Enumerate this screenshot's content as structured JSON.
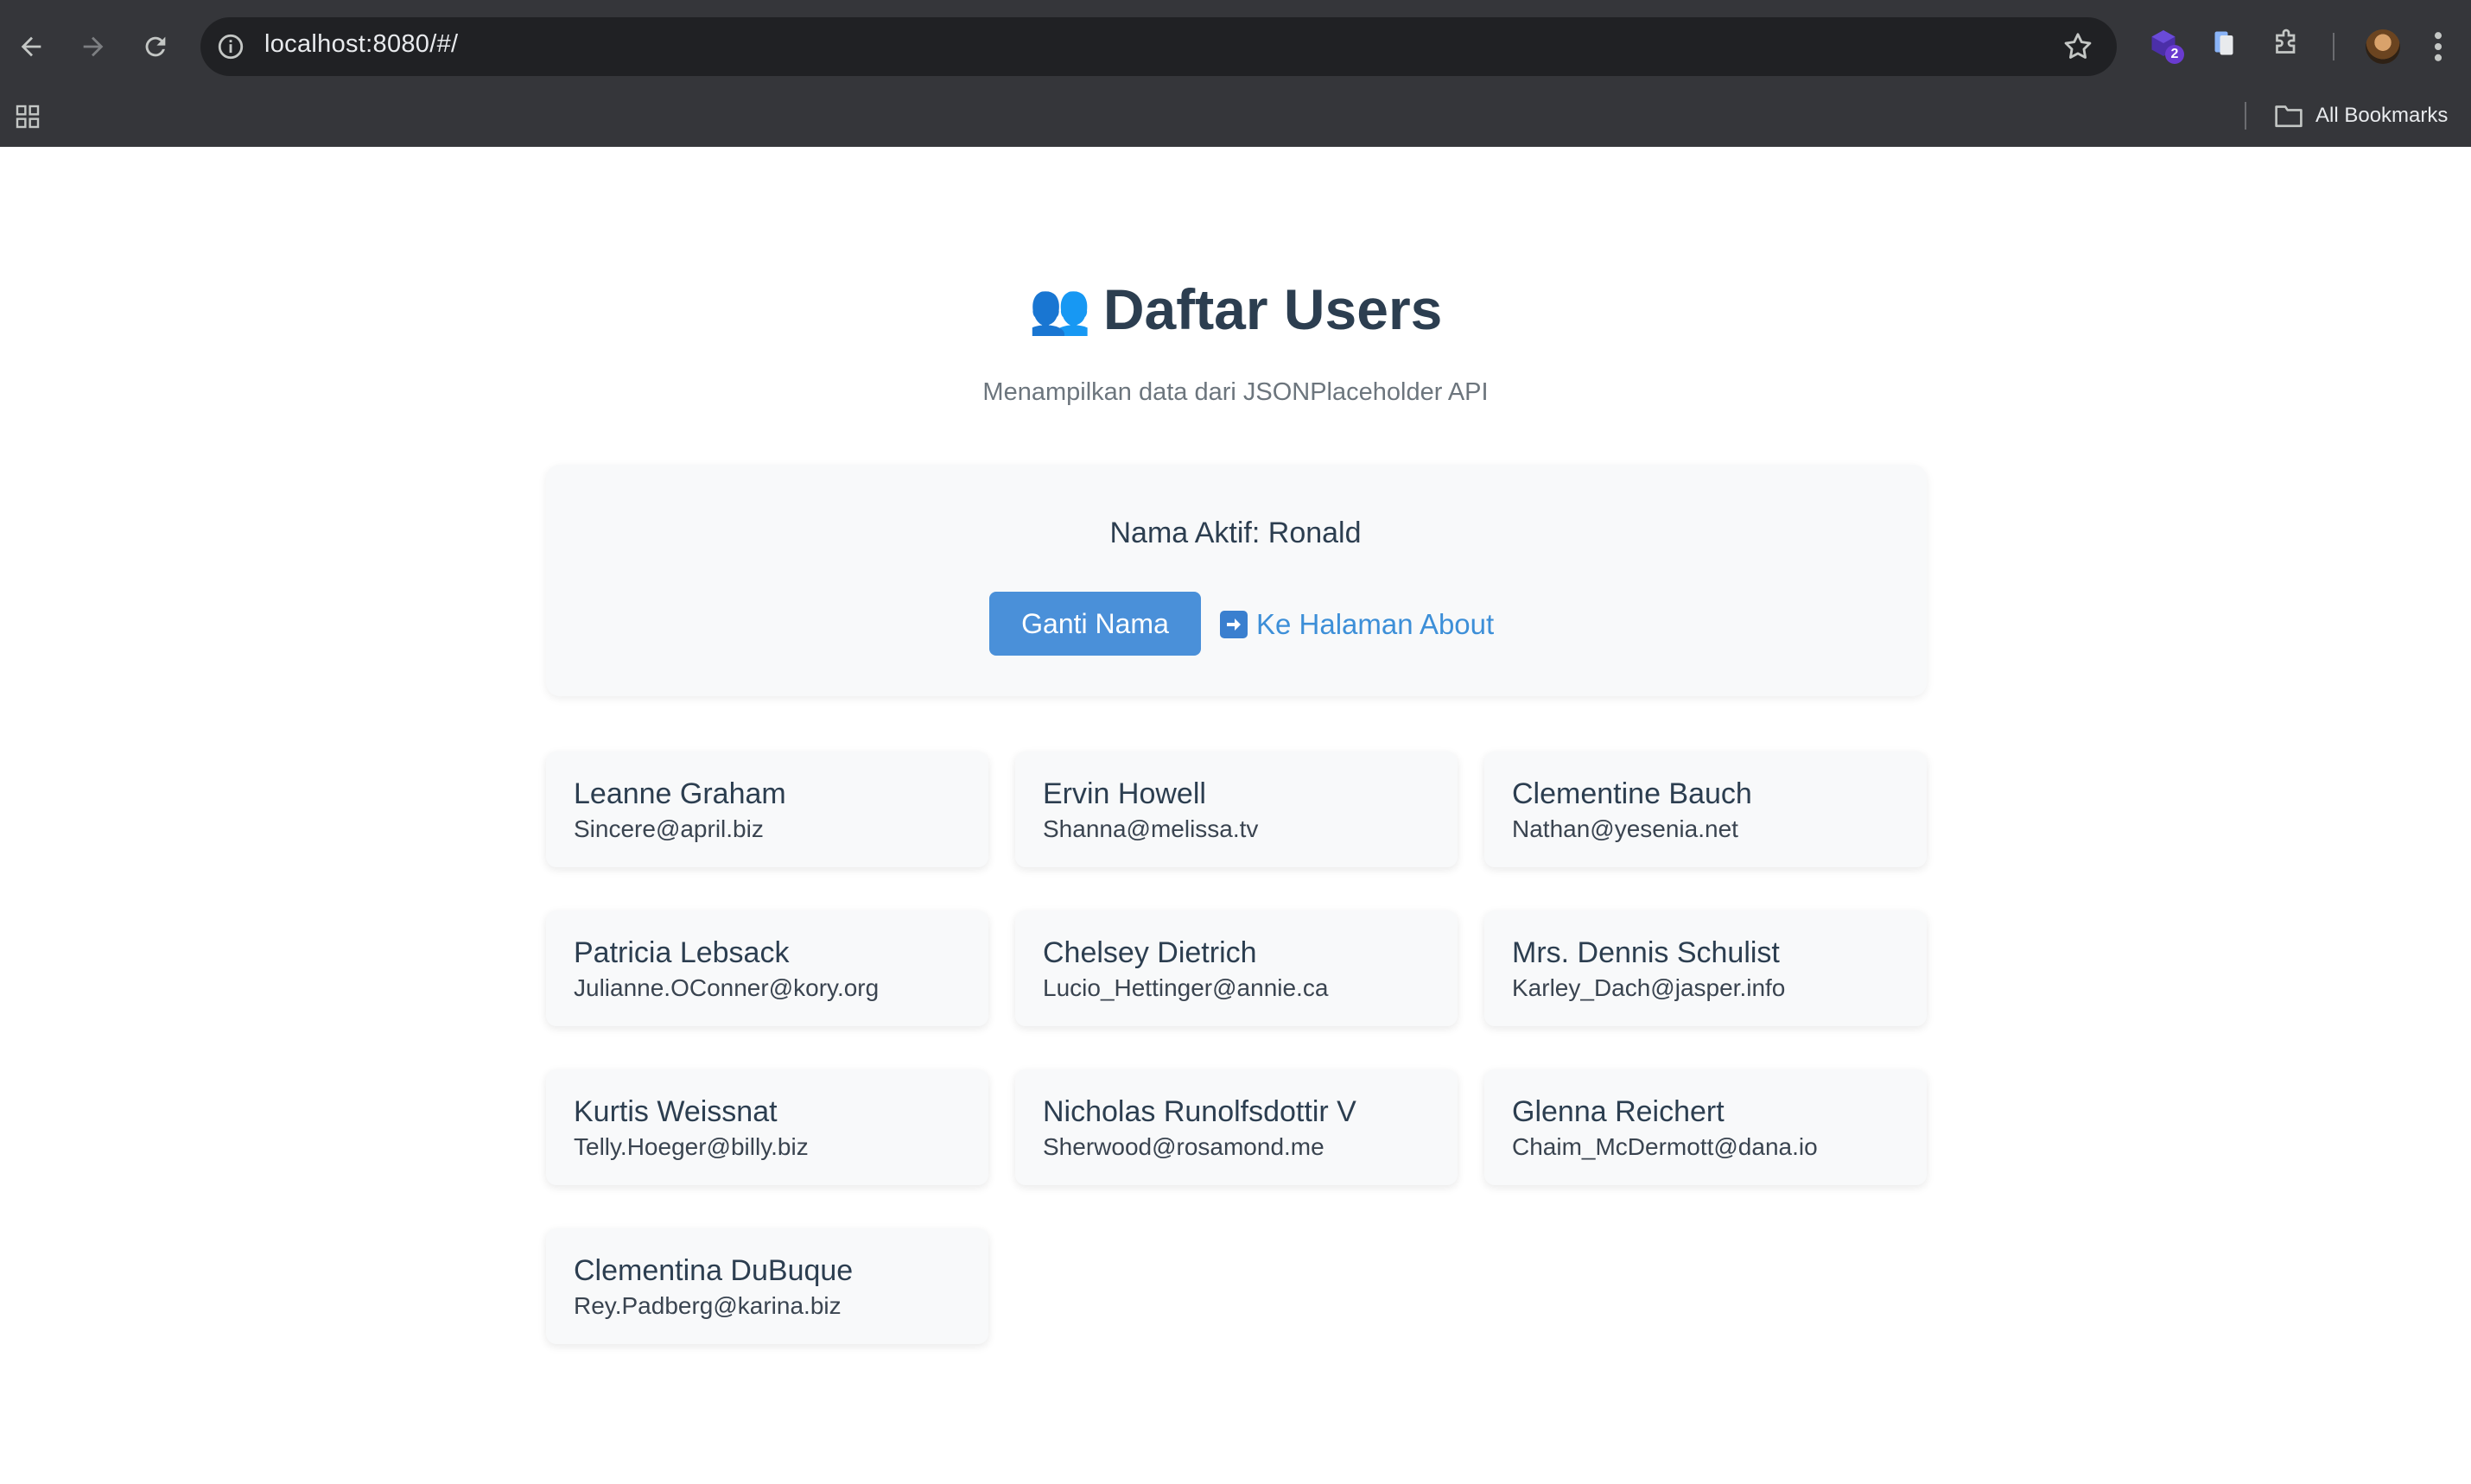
{
  "browser": {
    "url": "localhost:8080/#/",
    "extension_badge": "2",
    "bookmarks_label": "All Bookmarks"
  },
  "page": {
    "title_emoji": "👥",
    "title": "Daftar Users",
    "subtitle": "Menampilkan data dari JSONPlaceholder API",
    "active_name_text": "Nama Aktif: Ronald",
    "rename_button": "Ganti Nama",
    "about_link": "Ke Halaman About",
    "accent_color": "#4a90d9",
    "link_color": "#3d8fd8"
  },
  "users": [
    {
      "name": "Leanne Graham",
      "email": "Sincere@april.biz"
    },
    {
      "name": "Ervin Howell",
      "email": "Shanna@melissa.tv"
    },
    {
      "name": "Clementine Bauch",
      "email": "Nathan@yesenia.net"
    },
    {
      "name": "Patricia Lebsack",
      "email": "Julianne.OConner@kory.org"
    },
    {
      "name": "Chelsey Dietrich",
      "email": "Lucio_Hettinger@annie.ca"
    },
    {
      "name": "Mrs. Dennis Schulist",
      "email": "Karley_Dach@jasper.info"
    },
    {
      "name": "Kurtis Weissnat",
      "email": "Telly.Hoeger@billy.biz"
    },
    {
      "name": "Nicholas Runolfsdottir V",
      "email": "Sherwood@rosamond.me"
    },
    {
      "name": "Glenna Reichert",
      "email": "Chaim_McDermott@dana.io"
    },
    {
      "name": "Clementina DuBuque",
      "email": "Rey.Padberg@karina.biz"
    }
  ]
}
